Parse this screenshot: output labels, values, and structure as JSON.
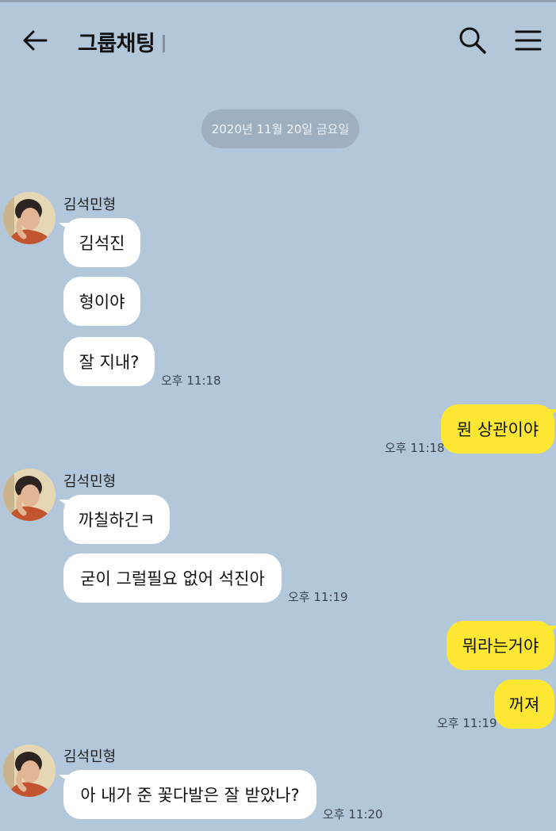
{
  "header": {
    "title": "그룹채팅",
    "back_icon": "arrow-left-icon",
    "search_icon": "search-icon",
    "menu_icon": "menu-icon"
  },
  "date_divider": "2020년 11월 20일 금요일",
  "colors": {
    "background": "#b2c7da",
    "incoming_bubble": "#ffffff",
    "outgoing_bubble": "#fde733",
    "date_pill": "#9eafbf"
  },
  "groups": [
    {
      "sender": "김석민형",
      "messages": [
        "김석진",
        "형이야",
        "잘 지내?"
      ],
      "time": "오후 11:18"
    },
    {
      "sender": "me",
      "messages": [
        "뭔 상관이야"
      ],
      "time": "오후 11:18"
    },
    {
      "sender": "김석민형",
      "messages": [
        "까칠하긴ㅋ",
        "굳이 그럴필요 없어 석진아"
      ],
      "time": "오후 11:19"
    },
    {
      "sender": "me",
      "messages": [
        "뭐라는거야",
        "꺼져"
      ],
      "time": "오후 11:19"
    },
    {
      "sender": "김석민형",
      "messages": [
        "아 내가 준 꽃다발은 잘 받았나?"
      ],
      "time": "오후 11:20"
    }
  ]
}
